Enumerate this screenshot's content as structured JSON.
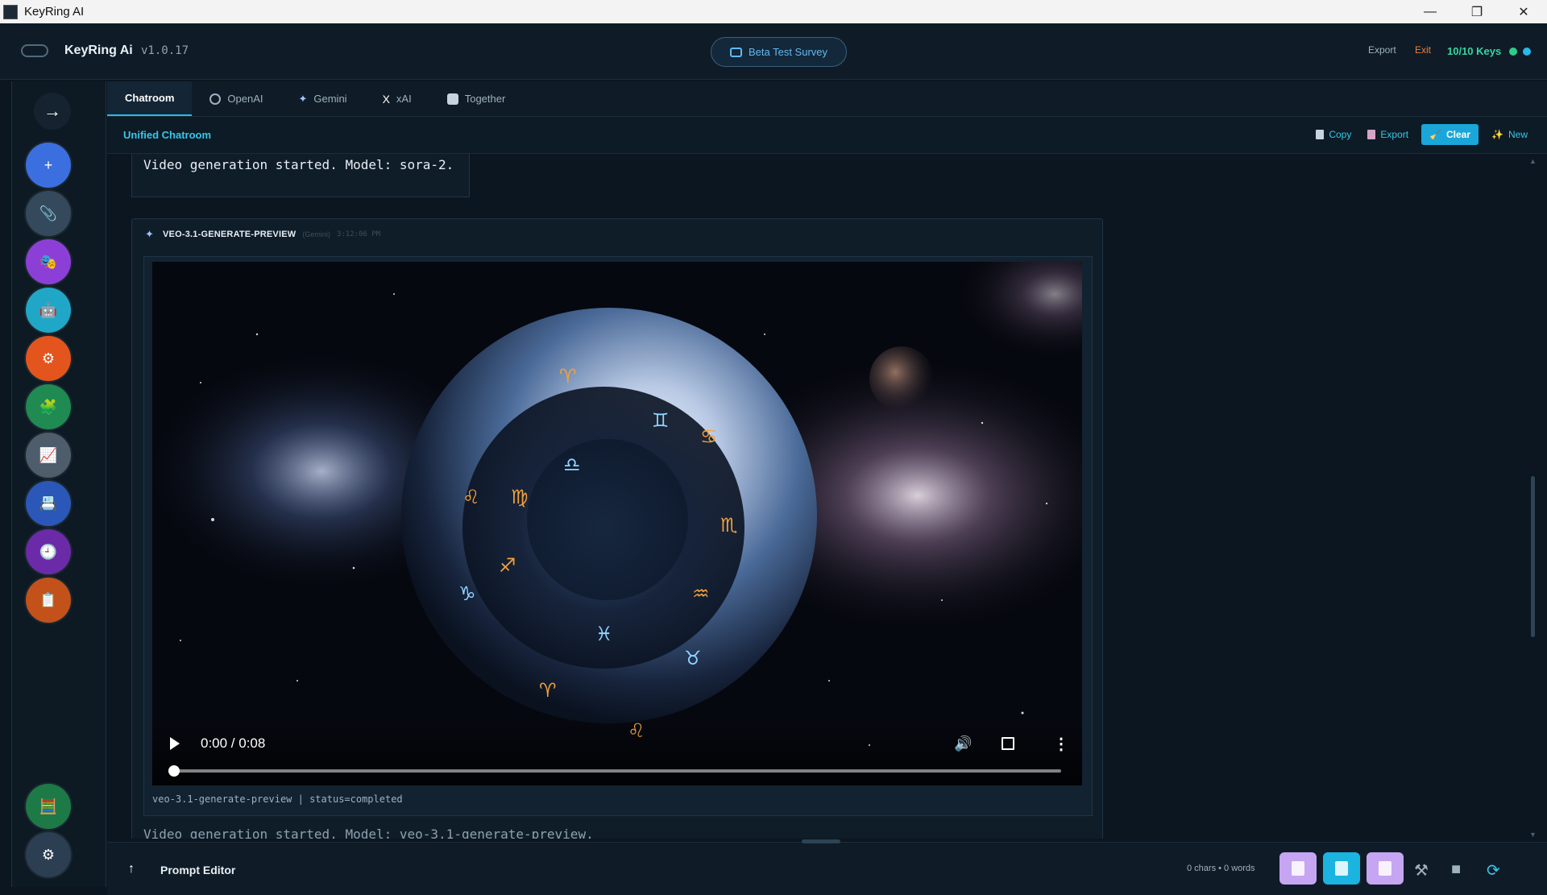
{
  "window": {
    "title": "KeyRing AI",
    "controls": [
      "—",
      "❐",
      "✕"
    ]
  },
  "header": {
    "app_name": "KeyRing Ai",
    "version": "v1.0.17",
    "survey_label": "Beta Test Survey",
    "export_label": "Export",
    "exit_label": "Exit",
    "keys_label": "10/10 Keys"
  },
  "sidebar": {
    "toggle_glyph": "→",
    "buttons": [
      {
        "name": "new",
        "glyph": "+",
        "color": "#3b6fe0"
      },
      {
        "name": "attach",
        "glyph": "📎",
        "color": "#34495b"
      },
      {
        "name": "masks",
        "glyph": "🎭",
        "color": "#8c3fd6"
      },
      {
        "name": "robot",
        "glyph": "🤖",
        "color": "#20a7c7"
      },
      {
        "name": "settings-orange",
        "glyph": "⚙",
        "color": "#e4541d"
      },
      {
        "name": "puzzle",
        "glyph": "🧩",
        "color": "#1f8a52"
      },
      {
        "name": "chart",
        "glyph": "📈",
        "color": "#4e5d6c"
      },
      {
        "name": "card",
        "glyph": "📇",
        "color": "#2a57b8"
      },
      {
        "name": "history",
        "glyph": "🕘",
        "color": "#6b2aa8"
      },
      {
        "name": "notes",
        "glyph": "📋",
        "color": "#c2521a"
      }
    ],
    "bottom_buttons": [
      {
        "name": "calculator",
        "glyph": "🧮",
        "color": "#1d7a46"
      },
      {
        "name": "settings",
        "glyph": "⚙",
        "color": "#2b3e52"
      }
    ]
  },
  "tabs": [
    {
      "label": "Chatroom",
      "active": true
    },
    {
      "label": "OpenAI",
      "active": false
    },
    {
      "label": "Gemini",
      "active": false
    },
    {
      "label": "xAI",
      "active": false
    },
    {
      "label": "Together",
      "active": false
    }
  ],
  "subbar": {
    "title": "Unified Chatroom",
    "actions": {
      "copy": "Copy",
      "export": "Export",
      "clear": "Clear",
      "new": "New"
    }
  },
  "chat": {
    "previous_message": "Video generation started. Model: sora-2.",
    "card": {
      "model": "VEO-3.1-GENERATE-PREVIEW",
      "provider": "(Gemini)",
      "time": "3:12:06 PM",
      "video": {
        "time": "0:00 / 0:08",
        "progress": 0.0
      },
      "caption": "veo-3.1-generate-preview | status=completed"
    },
    "next_message": "Video generation started. Model: veo-3.1-generate-preview."
  },
  "prompt": {
    "label": "Prompt Editor",
    "count": "0 chars • 0 words",
    "buttons": [
      {
        "name": "clipboard",
        "color": "#c6a5f2"
      },
      {
        "name": "mic",
        "color": "#1bb3e0"
      },
      {
        "name": "save",
        "color": "#c6a5f2"
      }
    ]
  },
  "colors": {
    "accent": "#38c6e8",
    "keys": "#35d6a1",
    "exit": "#ef7c3a",
    "background": "#0b1620"
  }
}
